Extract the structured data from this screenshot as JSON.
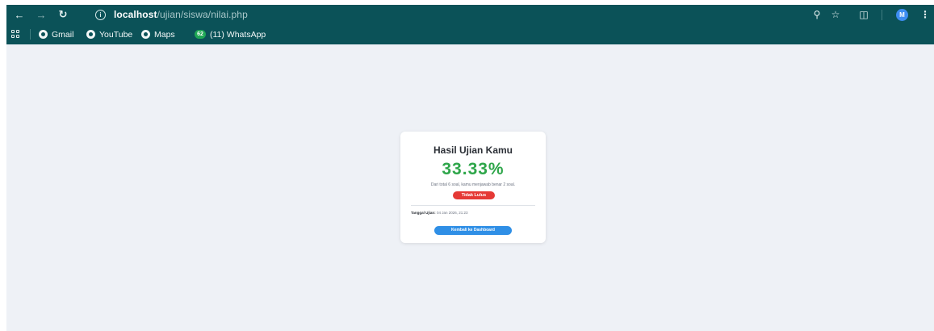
{
  "browser": {
    "url_host": "localhost",
    "url_path": "/ujian/siswa/nilai.php",
    "avatar_initial": "M",
    "icons": {
      "back": "arrow-left-icon",
      "forward": "arrow-right-icon",
      "reload": "reload-icon",
      "info": "info-icon",
      "zoom": "zoom-icon",
      "bookmark": "star-icon",
      "extensions": "puzzle-icon",
      "menu": "kebab-menu-icon"
    },
    "toolbar_color": "#0b5258"
  },
  "bookmarks": [
    {
      "label": "Gmail",
      "icon": "globe-icon"
    },
    {
      "label": "YouTube",
      "icon": "globe-icon"
    },
    {
      "label": "Maps",
      "icon": "globe-icon"
    },
    {
      "label": "(11) WhatsApp",
      "icon": "whatsapp-icon",
      "badge": "62"
    }
  ],
  "result": {
    "title": "Hasil Ujian Kamu",
    "score": "33.33%",
    "summary": "Dari total 6 soal, kamu menjawab benar 2 soal.",
    "status": "Tidak Lulus",
    "date_label": "Tanggal Ujian:",
    "date_value": "04 Jan 2026, 21:23",
    "back_button": "Kembali ke Dashboard",
    "colors": {
      "score": "#2ea64a",
      "status_badge": "#e53935",
      "button": "#2f8fe6",
      "page_bg": "#eef1f6"
    }
  }
}
